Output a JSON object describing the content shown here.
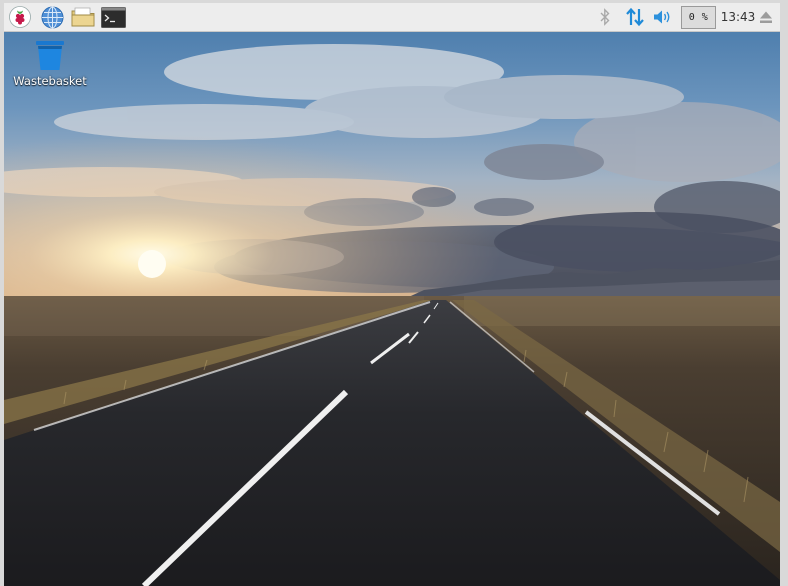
{
  "taskbar": {
    "launchers": [
      {
        "icon": "raspberry-pi-menu-icon"
      },
      {
        "icon": "web-browser-icon"
      },
      {
        "icon": "file-manager-icon"
      },
      {
        "icon": "terminal-icon"
      }
    ],
    "tray": {
      "bluetooth_icon": "bluetooth-icon",
      "network_icon": "network-updown-icon",
      "volume_icon": "volume-icon",
      "cpu_usage": "0 %",
      "clock": "13:43",
      "eject_icon": "eject-icon"
    },
    "colors": {
      "background": "#ededed",
      "network_accent": "#1f8ad8",
      "bluetooth_inactive": "#a9a9a9"
    }
  },
  "desktop": {
    "icons": [
      {
        "label": "Wastebasket",
        "icon": "trash-icon",
        "color": "#1a78cf"
      }
    ],
    "wallpaper": "road-sunset-landscape"
  }
}
